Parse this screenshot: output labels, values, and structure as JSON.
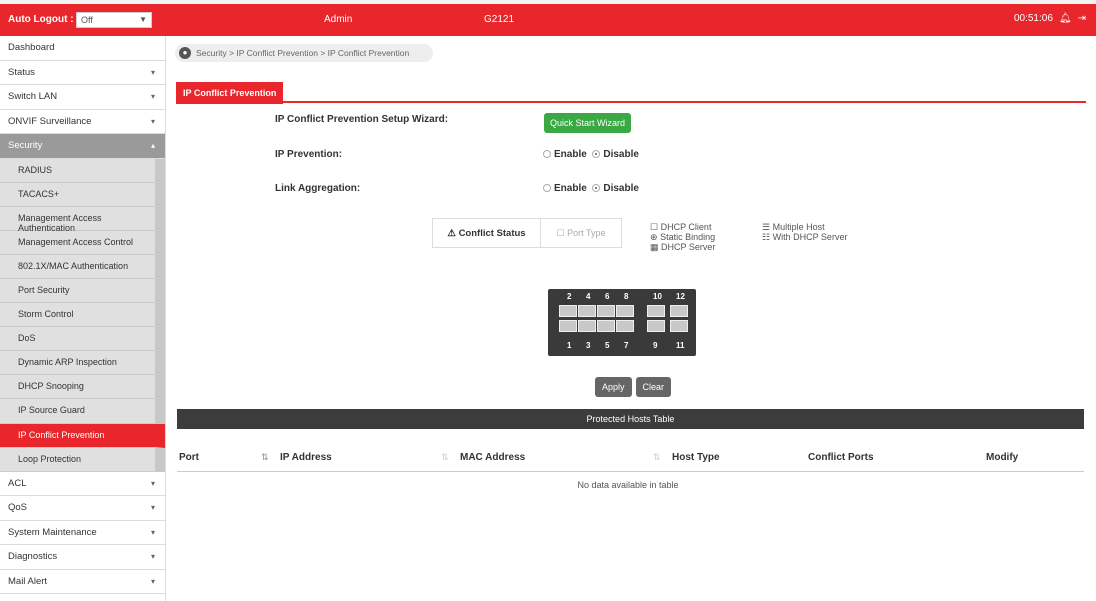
{
  "topbar": {
    "auto_logout_label": "Auto Logout :",
    "auto_logout_value": "Off",
    "user": "Admin",
    "model": "G2121",
    "time": "00:51:06"
  },
  "sidebar": {
    "top": [
      {
        "label": "Dashboard"
      },
      {
        "label": "Status"
      },
      {
        "label": "Switch LAN"
      },
      {
        "label": "ONVIF Surveillance"
      },
      {
        "label": "Security"
      }
    ],
    "security_sub": [
      "RADIUS",
      "TACACS+",
      "Management Access Authentication",
      "Management Access Control",
      "802.1X/MAC Authentication",
      "Port Security",
      "Storm Control",
      "DoS",
      "Dynamic ARP Inspection",
      "DHCP Snooping",
      "IP Source Guard",
      "IP Conflict Prevention",
      "Loop Protection"
    ],
    "bottom": [
      {
        "label": "ACL"
      },
      {
        "label": "QoS"
      },
      {
        "label": "System Maintenance"
      },
      {
        "label": "Diagnostics"
      },
      {
        "label": "Mail Alert"
      }
    ]
  },
  "breadcrumb": "Security > IP Conflict Prevention > IP Conflict Prevention",
  "tab": "IP Conflict Prevention",
  "form": {
    "wizard_label": "IP Conflict Prevention Setup Wizard:",
    "wizard_button": "Quick Start Wizard",
    "prevention_label": "IP Prevention:",
    "link_label": "Link Aggregation:",
    "enable": "Enable",
    "disable": "Disable"
  },
  "status_box": {
    "conflict": "Conflict Status",
    "port_type": "Port Type"
  },
  "legend": {
    "dhcp_client": "DHCP Client",
    "static_binding": "Static Binding",
    "dhcp_server": "DHCP Server",
    "multiple_host": "Multiple Host",
    "with_dhcp_server": "With DHCP Server"
  },
  "ports": {
    "top": [
      "2",
      "4",
      "6",
      "8",
      "10",
      "12"
    ],
    "bottom": [
      "1",
      "3",
      "5",
      "7",
      "9",
      "11"
    ]
  },
  "buttons": {
    "apply": "Apply",
    "clear": "Clear"
  },
  "table": {
    "title": "Protected Hosts Table",
    "columns": [
      "Port",
      "IP Address",
      "MAC Address",
      "Host Type",
      "Conflict Ports",
      "Modify"
    ],
    "empty": "No data available in table"
  }
}
